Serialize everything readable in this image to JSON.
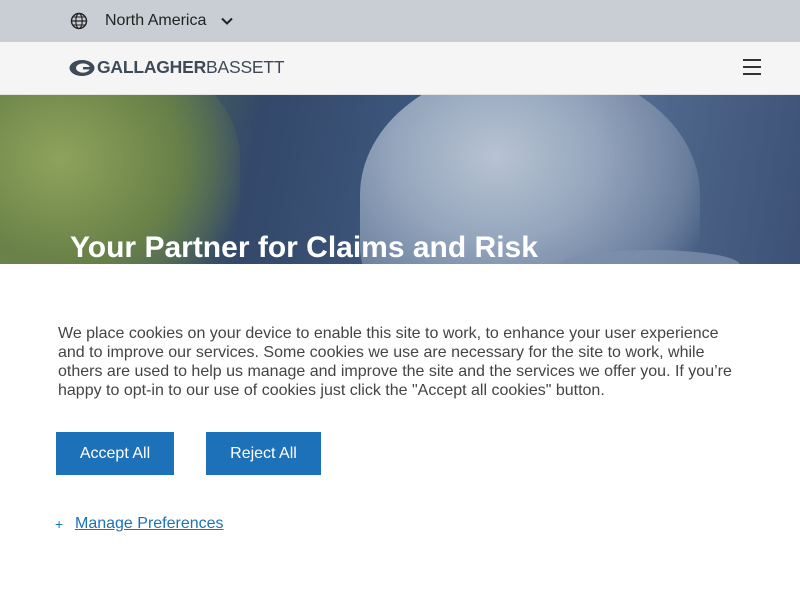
{
  "region": {
    "label": "North America"
  },
  "header": {
    "logo_bold": "GALLAGHER",
    "logo_light": "BASSETT"
  },
  "hero": {
    "title": "Your Partner for Claims and Risk"
  },
  "cookie_banner": {
    "message": "We place cookies on your device to enable this site to work, to enhance your user experience and to improve our services. Some cookies we use are necessary for the site to work, while others are used to help us manage and improve the site and the services we offer you. If you’re happy to opt-in to our use of cookies just click the \"Accept all cookies\" button.",
    "accept_label": "Accept All",
    "reject_label": "Reject All",
    "manage_plus": "+",
    "manage_label": "Manage Preferences"
  },
  "colors": {
    "accent": "#1d71b8",
    "region_bar": "#c9ced4",
    "header_bg": "#f5f5f5"
  },
  "icons": {
    "region": "globe-icon",
    "region_toggle": "chevron-down-icon",
    "menu": "hamburger-menu-icon"
  }
}
